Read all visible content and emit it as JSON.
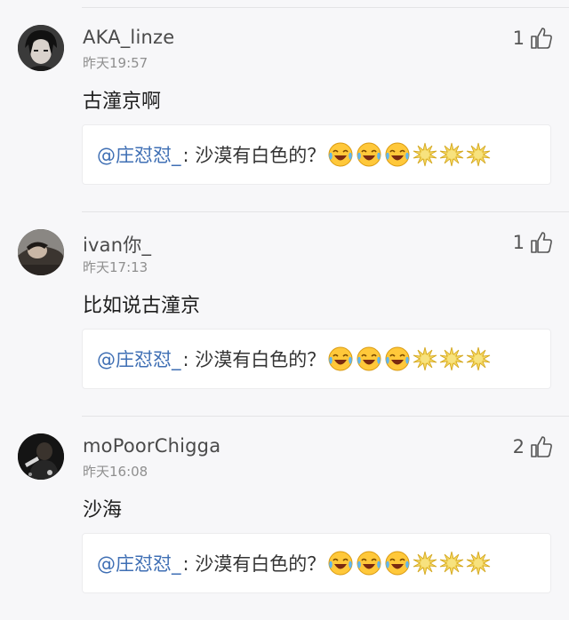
{
  "comments": [
    {
      "username": "AKA_linze",
      "time": "昨天19:57",
      "likes": "1",
      "text": "古潼京啊",
      "quote": {
        "mention": "@庄怼怼_",
        "text": ": 沙漠有白色的？"
      },
      "avatar": "avatar-dark-hair",
      "emojis": [
        "laugh-cry-emoji",
        "laugh-cry-emoji",
        "laugh-cry-emoji",
        "sun-emoji",
        "sun-emoji",
        "sun-emoji"
      ]
    },
    {
      "username": "ivan你_",
      "time": "昨天17:13",
      "likes": "1",
      "text": "比如说古潼京",
      "quote": {
        "mention": "@庄怼怼_",
        "text": ": 沙漠有白色的？"
      },
      "avatar": "avatar-sleeping-person",
      "emojis": [
        "laugh-cry-emoji",
        "laugh-cry-emoji",
        "laugh-cry-emoji",
        "sun-emoji",
        "sun-emoji",
        "sun-emoji"
      ]
    },
    {
      "username": "moPoorChigga",
      "time": "昨天16:08",
      "likes": "2",
      "text": "沙海",
      "quote": {
        "mention": "@庄怼怼_",
        "text": ": 沙漠有白色的？"
      },
      "avatar": "avatar-dark-figure",
      "emojis": [
        "laugh-cry-emoji",
        "laugh-cry-emoji",
        "laugh-cry-emoji",
        "sun-emoji",
        "sun-emoji",
        "sun-emoji"
      ]
    }
  ],
  "colors": {
    "mention": "#3f6fb4",
    "background": "#f7f7f9",
    "quote_bg": "#ffffff"
  }
}
